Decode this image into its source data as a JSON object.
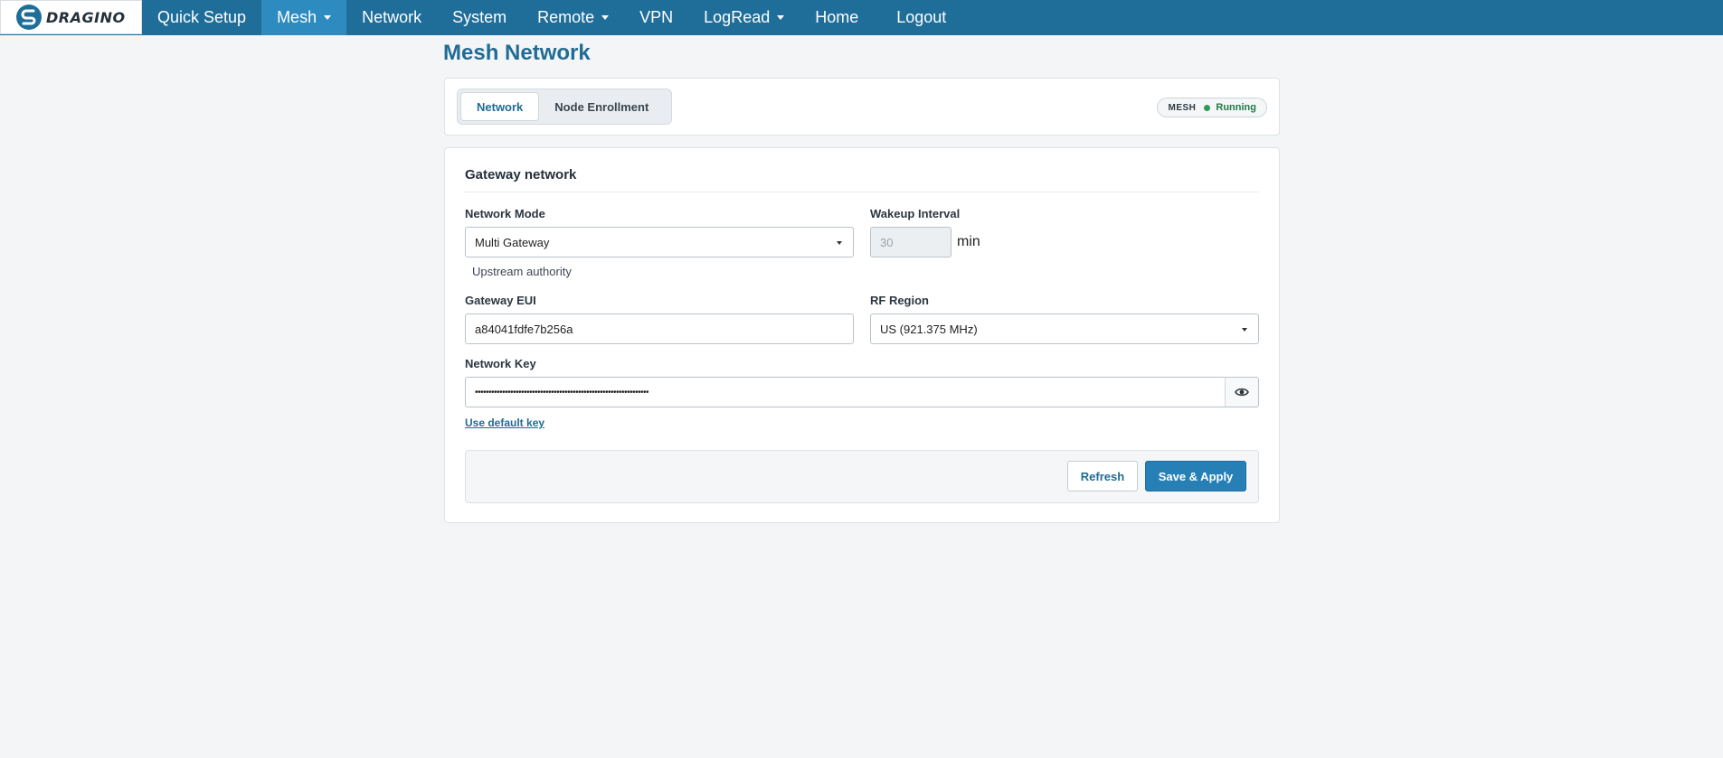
{
  "brand": {
    "logo_text": "DRAGINO"
  },
  "nav": {
    "items": [
      {
        "label": "Quick Setup"
      },
      {
        "label": "Mesh"
      },
      {
        "label": "Network"
      },
      {
        "label": "System"
      },
      {
        "label": "Remote"
      },
      {
        "label": "VPN"
      },
      {
        "label": "LogRead"
      },
      {
        "label": "Home"
      },
      {
        "label": "Logout"
      }
    ],
    "active": "Mesh",
    "accent_color": "#1f6e99",
    "active_color": "#2e8bc0"
  },
  "page": {
    "title": "Mesh Network"
  },
  "tabs": {
    "items": [
      {
        "label": "Network"
      },
      {
        "label": "Node Enrollment"
      }
    ],
    "selected": "Network"
  },
  "status": {
    "label": "MESH",
    "value": "Running",
    "color": "#2e9b57"
  },
  "form": {
    "section_title": "Gateway network",
    "network_mode": {
      "label": "Network Mode",
      "value": "Multi Gateway",
      "help": "Upstream authority"
    },
    "wakeup_interval": {
      "label": "Wakeup Interval",
      "value": "30",
      "unit": "min",
      "disabled": true
    },
    "gateway_eui": {
      "label": "Gateway EUI",
      "value": "a84041fdfe7b256a"
    },
    "rf_region": {
      "label": "RF Region",
      "value": "US (921.375 MHz)"
    },
    "network_key": {
      "label": "Network Key",
      "masked_value": "••••••••••••••••••••••••••••••••••••••••••••••••••••••••••••••••",
      "reveal_icon": "eye-icon",
      "default_link": "Use default key"
    }
  },
  "actions": {
    "refresh_label": "Refresh",
    "save_label": "Save & Apply",
    "save_color": "#2680b5"
  }
}
